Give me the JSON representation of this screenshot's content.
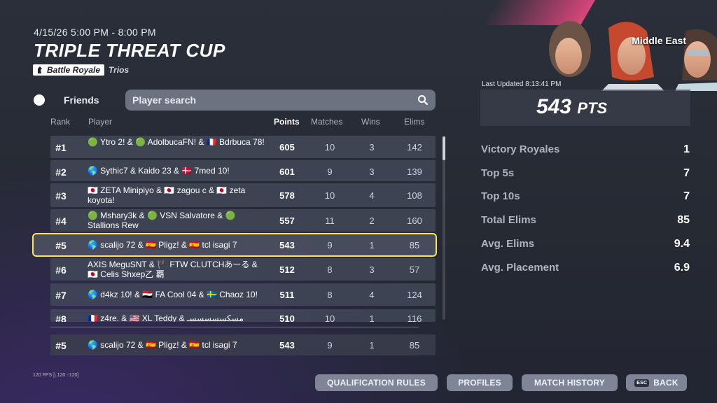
{
  "event": {
    "date_range": "4/15/26 5:00 PM - 8:00 PM",
    "title": "TRIPLE THREAT CUP",
    "mode": "Battle Royale",
    "team_size": "Trios"
  },
  "filters": {
    "friends_label": "Friends",
    "search_placeholder": "Player search"
  },
  "columns": {
    "rank": "Rank",
    "player": "Player",
    "points": "Points",
    "matches": "Matches",
    "wins": "Wins",
    "elims": "Elims"
  },
  "rows": [
    {
      "rank": "#1",
      "player": "🟢 Ytro 2! & 🟢 AdolbucaFN! & 🇫🇷 Bdrbuca 78!",
      "points": "605",
      "matches": "10",
      "wins": "3",
      "elims": "142"
    },
    {
      "rank": "#2",
      "player": "🌎 Sythic7 & Kaido 23 & 🇩🇰 7med 10!",
      "points": "601",
      "matches": "9",
      "wins": "3",
      "elims": "139"
    },
    {
      "rank": "#3",
      "player": "🇯🇵 ZETA Minipiyo & 🇯🇵 zagou c & 🇯🇵 zeta koyota!",
      "points": "578",
      "matches": "10",
      "wins": "4",
      "elims": "108"
    },
    {
      "rank": "#4",
      "player": "🟢 Mshary3k & 🟢 VSN Salvatore & 🟢 Stallions Rew",
      "points": "557",
      "matches": "11",
      "wins": "2",
      "elims": "160"
    },
    {
      "rank": "#5",
      "player": "🌎 scalijo 72 & 🇪🇸 Pligz! & 🇪🇸 tcl isagi 7",
      "points": "543",
      "matches": "9",
      "wins": "1",
      "elims": "85"
    },
    {
      "rank": "#6",
      "player": "AXIS MeguSNT & 🏴 FTW CLUTCHあーる & 🇯🇵 Celis Shxep乙 覇",
      "points": "512",
      "matches": "8",
      "wins": "3",
      "elims": "57"
    },
    {
      "rank": "#7",
      "player": "🌎 d4kz 10! & 🇪🇬 FA Cool 04 & 🇸🇪 Chaoz 10!",
      "points": "511",
      "matches": "8",
      "wins": "4",
      "elims": "124"
    },
    {
      "rank": "#8",
      "player": "🇫🇷 z4re. & 🇺🇸 XL Teddy & مسكسسسسسـ",
      "points": "510",
      "matches": "10",
      "wins": "1",
      "elims": "116"
    }
  ],
  "my_row": {
    "rank": "#5",
    "player": "🌎 scalijo 72 & 🇪🇸 Pligz! & 🇪🇸 tcl isagi 7",
    "points": "543",
    "matches": "9",
    "wins": "1",
    "elims": "85"
  },
  "summary": {
    "region": "Middle East",
    "last_updated": "Last Updated 8:13:41 PM",
    "points_value": "543",
    "points_unit": "PTS"
  },
  "stats": [
    {
      "label": "Victory Royales",
      "value": "1"
    },
    {
      "label": "Top 5s",
      "value": "7"
    },
    {
      "label": "Top 10s",
      "value": "7"
    },
    {
      "label": "Total Elims",
      "value": "85"
    },
    {
      "label": "Avg. Elims",
      "value": "9.4"
    },
    {
      "label": "Avg. Placement",
      "value": "6.9"
    }
  ],
  "footer": {
    "fps": "120 FPS [↓120 ↑120]",
    "qualification_rules": "QUALIFICATION RULES",
    "profiles": "PROFILES",
    "match_history": "MATCH HISTORY",
    "esc_key": "ESC",
    "back": "BACK"
  },
  "colors": {
    "highlight": "#f6e85a",
    "accent_pink": "#d8467a",
    "button": "#7f8597"
  }
}
